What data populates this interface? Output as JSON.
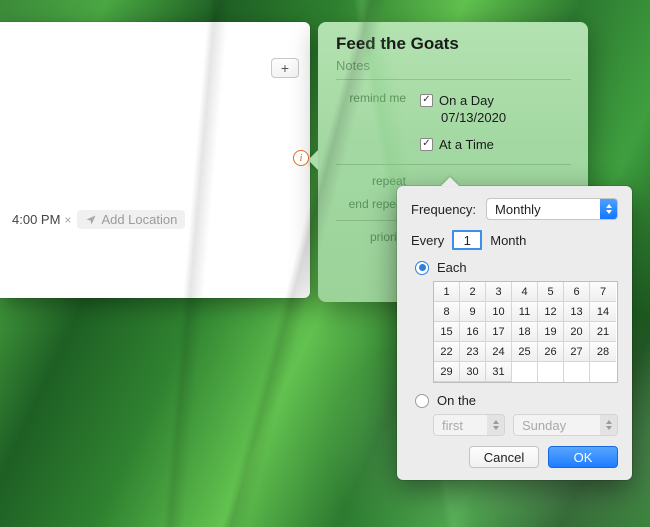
{
  "left": {
    "add_icon": "+",
    "time": "4:00 PM",
    "close_glyph": "×",
    "add_location": "Add Location"
  },
  "card": {
    "title": "Feed the Goats",
    "notes_placeholder": "Notes",
    "remind_me_label": "remind me",
    "on_a_day": "On a Day",
    "date": "07/13/2020",
    "at_a_time": "At a Time",
    "repeat_label": "repeat",
    "end_repeat_label": "end repeat",
    "priority_label": "priority"
  },
  "popover": {
    "frequency_label": "Frequency:",
    "frequency_value": "Monthly",
    "every_label": "Every",
    "every_value": "1",
    "every_unit": "Month",
    "each_label": "Each",
    "days": [
      "1",
      "2",
      "3",
      "4",
      "5",
      "6",
      "7",
      "8",
      "9",
      "10",
      "11",
      "12",
      "13",
      "14",
      "15",
      "16",
      "17",
      "18",
      "19",
      "20",
      "21",
      "22",
      "23",
      "24",
      "25",
      "26",
      "27",
      "28",
      "29",
      "30",
      "31"
    ],
    "on_the_label": "On the",
    "ordinal_value": "first",
    "weekday_value": "Sunday",
    "cancel": "Cancel",
    "ok": "OK"
  },
  "info_glyph": "i"
}
